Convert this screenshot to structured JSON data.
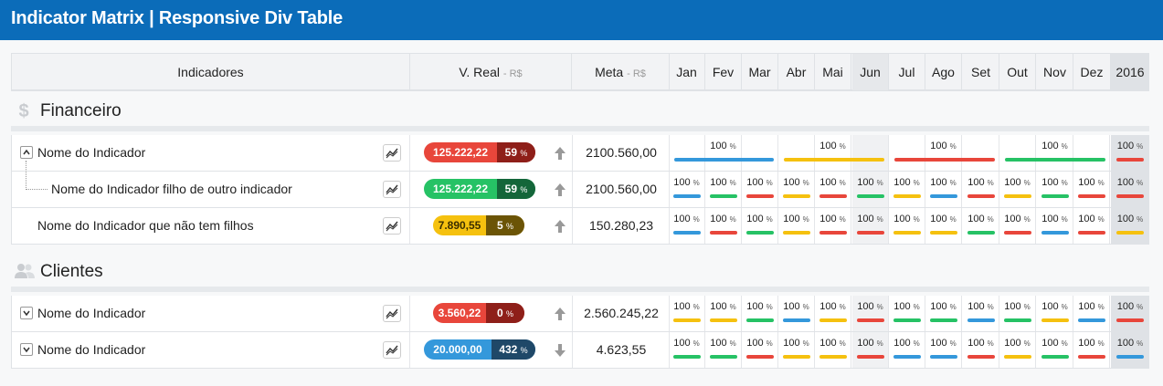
{
  "app": {
    "title": "Indicator Matrix | Responsive Div Table"
  },
  "colors": {
    "red": "#e8463b",
    "green": "#26c265",
    "yellow": "#f5c10f",
    "blue": "#3498db",
    "red_dark": "#8e1f19",
    "green_dark": "#14663a",
    "yellow_dark": "#6b5406",
    "red_dark2": "#7b1a15",
    "blue_dark": "#1f4868"
  },
  "header": {
    "indicadores": "Indicadores",
    "vreal": "V. Real",
    "vreal_unit": "- R$",
    "meta": "Meta",
    "meta_unit": "- R$",
    "months": [
      "Jan",
      "Fev",
      "Mar",
      "Abr",
      "Mai",
      "Jun",
      "Jul",
      "Ago",
      "Set",
      "Out",
      "Nov",
      "Dez"
    ],
    "year": "2016"
  },
  "sections": [
    {
      "name": "Financeiro",
      "icon": "dollar-icon",
      "rows": [
        {
          "name": "Nome do Indicador",
          "toggle": "^",
          "value": "125.222,22",
          "percent": "59",
          "color": "red",
          "trend": "up",
          "meta": "2100.560,00",
          "quarterly": true,
          "quarters": [
            {
              "pct": "100",
              "color": "blue"
            },
            {
              "pct": "100",
              "color": "yellow"
            },
            {
              "pct": "100",
              "color": "red"
            },
            {
              "pct": "100",
              "color": "green"
            }
          ],
          "year": {
            "pct": "100",
            "color": "red"
          }
        },
        {
          "name": "Nome do Indicador filho de outro indicador",
          "child": true,
          "value": "125.222,22",
          "percent": "59",
          "color": "green",
          "trend": "up",
          "meta": "2100.560,00",
          "months": [
            {
              "pct": "100",
              "color": "blue"
            },
            {
              "pct": "100",
              "color": "green"
            },
            {
              "pct": "100",
              "color": "red"
            },
            {
              "pct": "100",
              "color": "yellow"
            },
            {
              "pct": "100",
              "color": "red"
            },
            {
              "pct": "100",
              "color": "green"
            },
            {
              "pct": "100",
              "color": "yellow"
            },
            {
              "pct": "100",
              "color": "blue"
            },
            {
              "pct": "100",
              "color": "red"
            },
            {
              "pct": "100",
              "color": "yellow"
            },
            {
              "pct": "100",
              "color": "green"
            },
            {
              "pct": "100",
              "color": "red"
            }
          ],
          "year": {
            "pct": "100",
            "color": "red"
          }
        },
        {
          "name": "Nome do Indicador que não tem filhos",
          "value": "7.890,55",
          "percent": "5",
          "color": "yellow",
          "trend": "up",
          "meta": "150.280,23",
          "months": [
            {
              "pct": "100",
              "color": "blue"
            },
            {
              "pct": "100",
              "color": "red"
            },
            {
              "pct": "100",
              "color": "green"
            },
            {
              "pct": "100",
              "color": "yellow"
            },
            {
              "pct": "100",
              "color": "red"
            },
            {
              "pct": "100",
              "color": "red"
            },
            {
              "pct": "100",
              "color": "yellow"
            },
            {
              "pct": "100",
              "color": "yellow"
            },
            {
              "pct": "100",
              "color": "green"
            },
            {
              "pct": "100",
              "color": "red"
            },
            {
              "pct": "100",
              "color": "blue"
            },
            {
              "pct": "100",
              "color": "red"
            }
          ],
          "year": {
            "pct": "100",
            "color": "yellow"
          }
        }
      ]
    },
    {
      "name": "Clientes",
      "icon": "users-icon",
      "rows": [
        {
          "name": "Nome do Indicador",
          "toggle": "v",
          "value": "3.560,22",
          "percent": "0",
          "color": "red",
          "trend": "up",
          "meta": "2.560.245,22",
          "months": [
            {
              "pct": "100",
              "color": "yellow"
            },
            {
              "pct": "100",
              "color": "yellow"
            },
            {
              "pct": "100",
              "color": "green"
            },
            {
              "pct": "100",
              "color": "blue"
            },
            {
              "pct": "100",
              "color": "yellow"
            },
            {
              "pct": "100",
              "color": "red"
            },
            {
              "pct": "100",
              "color": "green"
            },
            {
              "pct": "100",
              "color": "green"
            },
            {
              "pct": "100",
              "color": "blue"
            },
            {
              "pct": "100",
              "color": "green"
            },
            {
              "pct": "100",
              "color": "yellow"
            },
            {
              "pct": "100",
              "color": "blue"
            }
          ],
          "year": {
            "pct": "100",
            "color": "red"
          }
        },
        {
          "name": "Nome do Indicador",
          "toggle": "v",
          "value": "20.000,00",
          "percent": "432",
          "color": "blue",
          "trend": "down",
          "meta": "4.623,55",
          "months": [
            {
              "pct": "100",
              "color": "green"
            },
            {
              "pct": "100",
              "color": "green"
            },
            {
              "pct": "100",
              "color": "red"
            },
            {
              "pct": "100",
              "color": "yellow"
            },
            {
              "pct": "100",
              "color": "yellow"
            },
            {
              "pct": "100",
              "color": "red"
            },
            {
              "pct": "100",
              "color": "blue"
            },
            {
              "pct": "100",
              "color": "blue"
            },
            {
              "pct": "100",
              "color": "red"
            },
            {
              "pct": "100",
              "color": "yellow"
            },
            {
              "pct": "100",
              "color": "green"
            },
            {
              "pct": "100",
              "color": "red"
            }
          ],
          "year": {
            "pct": "100",
            "color": "blue"
          }
        }
      ]
    }
  ],
  "pct_unit": "%"
}
